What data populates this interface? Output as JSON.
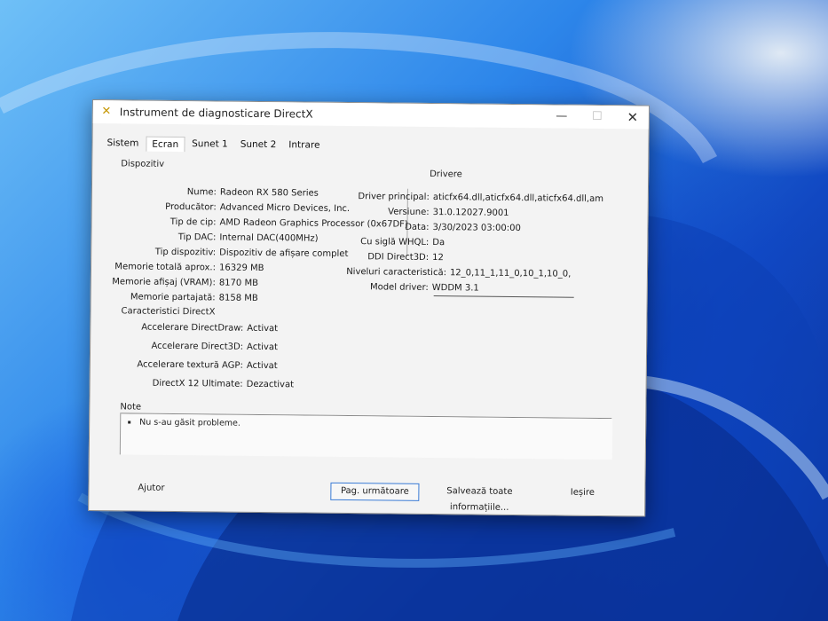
{
  "window": {
    "title": "Instrument de diagnosticare DirectX",
    "close_label": "✕",
    "minimize_label": "—",
    "maximize_label": "☐"
  },
  "tabs": [
    {
      "label": "Sistem"
    },
    {
      "label": "Ecran"
    },
    {
      "label": "Sunet 1"
    },
    {
      "label": "Sunet 2"
    },
    {
      "label": "Intrare"
    }
  ],
  "device": {
    "section_label": "Dispozitiv",
    "rows": [
      {
        "key": "Nume:",
        "value": "Radeon RX 580 Series"
      },
      {
        "key": "Producător:",
        "value": "Advanced Micro Devices, Inc."
      },
      {
        "key": "Tip de cip:",
        "value": "AMD Radeon Graphics Processor (0x67DF)"
      },
      {
        "key": "Tip DAC:",
        "value": "Internal DAC(400MHz)"
      },
      {
        "key": "Tip dispozitiv:",
        "value": "Dispozitiv de afișare complet"
      },
      {
        "key": "Memorie totală aprox.:",
        "value": "16329 MB"
      },
      {
        "key": "Memorie afișaj (VRAM):",
        "value": "8170 MB"
      },
      {
        "key": "Memorie partajată:",
        "value": "8158 MB"
      }
    ]
  },
  "drivers": {
    "section_label": "Drivere",
    "rows": [
      {
        "key": "Driver principal:",
        "value": "aticfx64.dll,aticfx64.dll,aticfx64.dll,am"
      },
      {
        "key": "Versiune:",
        "value": "31.0.12027.9001"
      },
      {
        "key": "Data:",
        "value": "3/30/2023 03:00:00"
      },
      {
        "key": "Cu siglă WHQL:",
        "value": "Da"
      },
      {
        "key": "DDI Direct3D:",
        "value": "12"
      },
      {
        "key": "Niveluri caracteristică:",
        "value": "12_0,11_1,11_0,10_1,10_0,"
      },
      {
        "key": "Model driver:",
        "value": "WDDM 3.1"
      }
    ]
  },
  "features": {
    "section_label": "Caracteristici DirectX",
    "rows": [
      {
        "key": "Accelerare DirectDraw:",
        "value": "Activat"
      },
      {
        "key": "Accelerare Direct3D:",
        "value": "Activat"
      },
      {
        "key": "Accelerare textură AGP:",
        "value": "Activat"
      },
      {
        "key": "DirectX 12 Ultimate:",
        "value": "Dezactivat"
      }
    ]
  },
  "notes": {
    "section_label": "Note",
    "items": [
      "Nu s-au găsit probleme."
    ]
  },
  "buttons": {
    "help": "Ajutor",
    "next_page": "Pag. următoare",
    "save_all": "Salvează toate informațiile...",
    "exit": "Ieșire"
  },
  "icons": {
    "app": "directx-icon",
    "close": "close-icon"
  },
  "colors": {
    "accent": "#3a7bd5",
    "wallpaper": "#1148c2"
  }
}
